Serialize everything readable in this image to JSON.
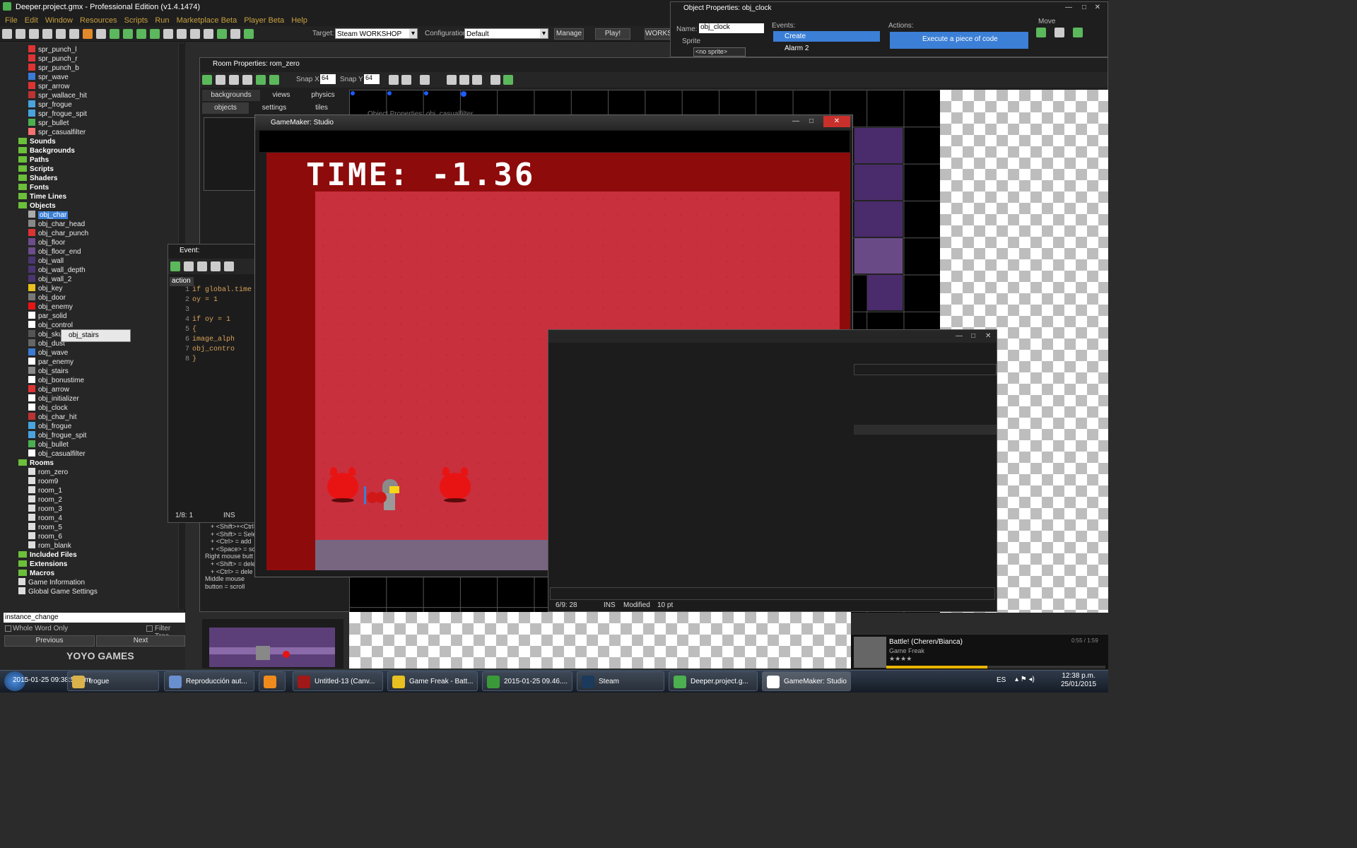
{
  "main_window": {
    "title": "Deeper.project.gmx  -  Professional Edition (v1.4.1474)"
  },
  "menu": [
    "File",
    "Edit",
    "Window",
    "Resources",
    "Scripts",
    "Run",
    "Marketplace Beta",
    "Player Beta",
    "Help"
  ],
  "toolbar": {
    "target_label": "Target:",
    "target_value": "Steam WORKSHOP",
    "config_label": "Configuration:",
    "config_value": "Default",
    "manage": "Manage",
    "play": "Play!",
    "workshop": "WORKS"
  },
  "tree": {
    "sprites": [
      "spr_punch_l",
      "spr_punch_r",
      "spr_punch_b",
      "spr_wave",
      "spr_arrow",
      "spr_wallace_hit",
      "spr_frogue",
      "spr_frogue_spit",
      "spr_bullet",
      "spr_casualfilter"
    ],
    "folders_a": [
      "Sounds",
      "Backgrounds",
      "Paths",
      "Scripts",
      "Shaders",
      "Fonts",
      "Time Lines",
      "Objects"
    ],
    "objects": [
      "obj_char",
      "obj_char_head",
      "obj_char_punch",
      "obj_floor",
      "obj_floor_end",
      "obj_wall",
      "obj_wall_depth",
      "obj_wall_2",
      "obj_key",
      "obj_door",
      "obj_enemy",
      "par_solid",
      "obj_control",
      "obj_skull",
      "obj_dust",
      "obj_wave",
      "par_enemy",
      "obj_stairs",
      "obj_bonustime",
      "obj_arrow",
      "obj_initializer",
      "obj_clock",
      "obj_char_hit",
      "obj_frogue",
      "obj_frogue_spit",
      "obj_bullet",
      "obj_casualfilter"
    ],
    "rooms_label": "Rooms",
    "rooms": [
      "rom_zero",
      "room9",
      "room_1",
      "room_2",
      "room_3",
      "room_4",
      "room_5",
      "room_6",
      "rom_blank"
    ],
    "folders_b": [
      "Included Files",
      "Extensions",
      "Macros",
      "Game Information",
      "Global Game Settings"
    ],
    "tooltip": "obj_stairs"
  },
  "search": {
    "value": "instance_change",
    "whole_word": "Whole Word Only",
    "filter": "Filter Tree",
    "prev": "Previous",
    "next": "Next"
  },
  "logo": "YOYO GAMES",
  "room_window": {
    "title": "Room Properties: rom_zero",
    "snap_x_label": "Snap X",
    "snap_x": "64",
    "snap_y_label": "Snap Y",
    "snap_y": "64",
    "tabs_top": [
      "backgrounds",
      "views",
      "physics"
    ],
    "tabs_bottom": [
      "objects",
      "settings",
      "tiles"
    ]
  },
  "event_window": {
    "title": "Event: obj_casualfilter_St",
    "tab": "action",
    "lines": [
      "if global.time",
      "    oy = 1",
      "",
      "if oy = 1",
      "    {",
      "    image_alph",
      "    obj_contro",
      "    }"
    ],
    "status": "1/8:  1",
    "mode": "INS"
  },
  "hints": [
    "+ <Shift>+<Ctrl>",
    "+ <Shift> = Sele",
    "+ <Ctrl> = add",
    "+ <Space> = scr",
    "Right mouse butt",
    "+ <Shift> = dele",
    "+ <Ctrl> = dele",
    "Middle mouse button = scroll"
  ],
  "object_props": {
    "title": "Object Properties: obj_clock",
    "name_label": "Name:",
    "name": "obj_clock",
    "sprite_label": "Sprite",
    "sprite_value": "<no sprite>",
    "events_label": "Events:",
    "events": [
      "Create",
      "Alarm 2"
    ],
    "actions_label": "Actions:",
    "action": "Execute a piece of code",
    "move_label": "Move"
  },
  "game_window": {
    "title": "GameMaker: Studio",
    "timer": "TIME: -1.36"
  },
  "ghost_title": "Object Properties: obj_casualfilter",
  "code_status": {
    "pos": "6/9:  28",
    "mode": "INS",
    "modified": "Modified",
    "size": "10 pt"
  },
  "media": {
    "title": "Battle! (Cheren/Bianca)",
    "artist": "Game Freak",
    "time": "0:55 / 1:59"
  },
  "taskbar": {
    "items": [
      "frogue",
      "Reproducción aut...",
      "",
      "Untitled-13 (Canv...",
      "Game Freak - Batt...",
      "2015-01-25 09.46....",
      "Steam",
      "Deeper.project.g...",
      "GameMaker: Studio"
    ],
    "lang": "ES",
    "time": "12:38 p.m.",
    "date": "25/01/2015",
    "overlay": "2015-01-25 09:38:59 pm"
  }
}
